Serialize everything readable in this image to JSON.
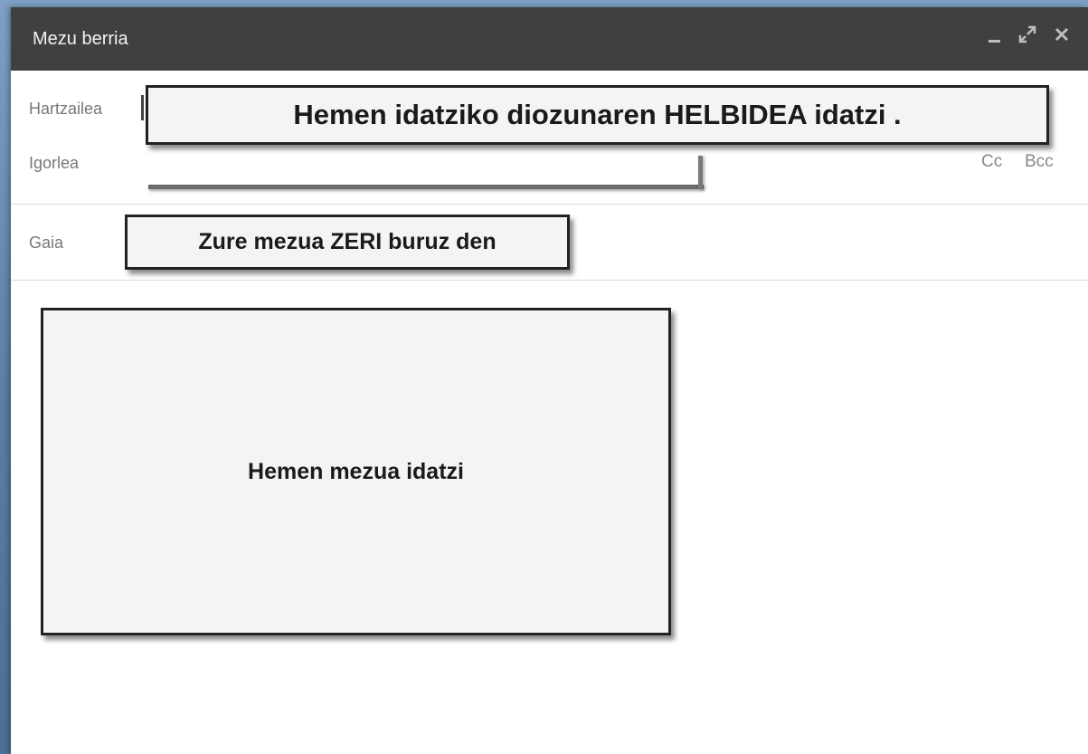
{
  "window": {
    "title": "Mezu berria",
    "controls": {
      "minimize_icon": "minimize-icon",
      "expand_icon": "expand-icon",
      "close_icon": "close-icon"
    }
  },
  "fields": {
    "to_label": "Hartzailea",
    "from_label": "Igorlea",
    "subject_label": "Gaia",
    "cc_label": "Cc",
    "bcc_label": "Bcc"
  },
  "callouts": {
    "to": "Hemen idatziko diozunaren HELBIDEA idatzi .",
    "subject": "Zure mezua ZERI buruz den",
    "body": "Hemen mezua idatzi"
  },
  "colors": {
    "titlebar_bg": "#404040",
    "backdrop": "#5b7ea6",
    "callout_bg": "#f4f4f4",
    "callout_border": "#222222"
  }
}
